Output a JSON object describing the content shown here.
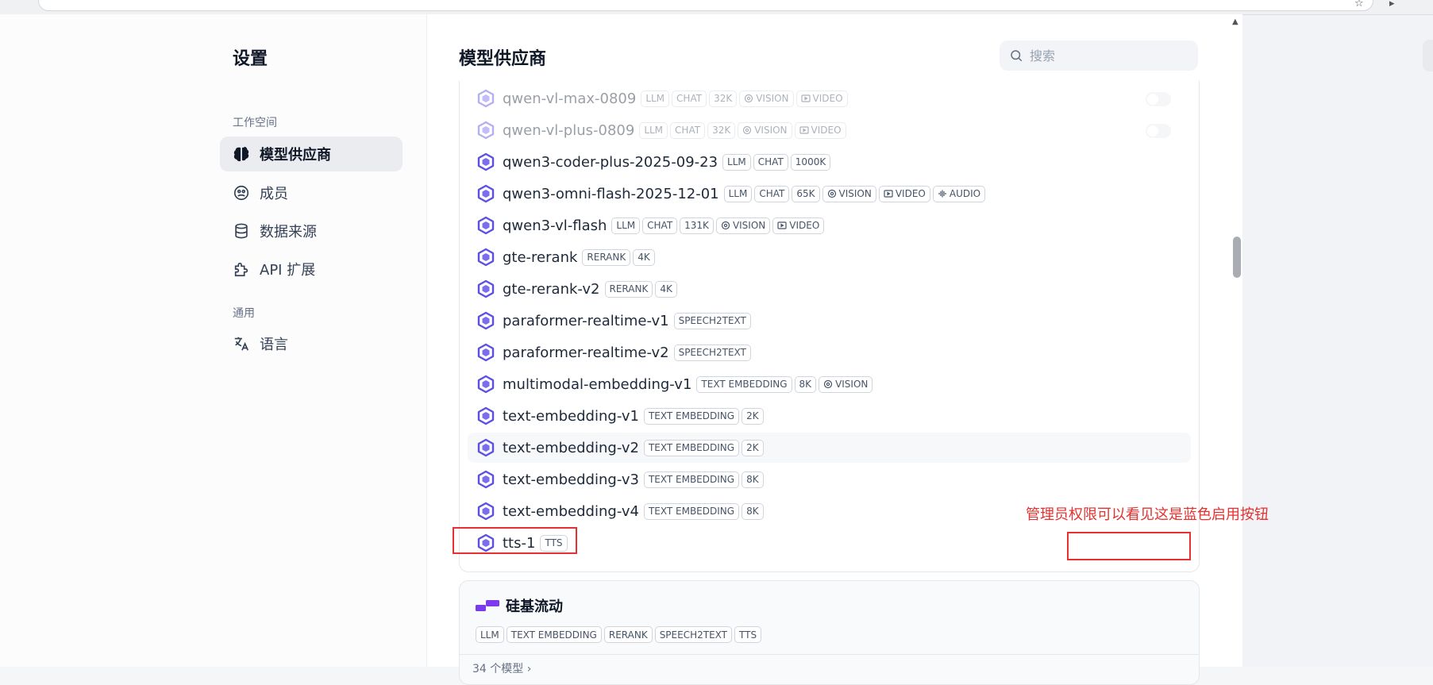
{
  "sidebar": {
    "title": "设置",
    "sections": [
      {
        "label": "工作空间",
        "items": [
          {
            "label": "模型供应商",
            "icon": "brain-icon",
            "active": true
          },
          {
            "label": "成员",
            "icon": "members-icon"
          },
          {
            "label": "数据来源",
            "icon": "database-icon"
          },
          {
            "label": "API 扩展",
            "icon": "puzzle-icon"
          }
        ]
      },
      {
        "label": "通用",
        "items": [
          {
            "label": "语言",
            "icon": "translate-icon"
          }
        ]
      }
    ]
  },
  "main": {
    "title": "模型供应商",
    "search": {
      "placeholder": "搜索",
      "value": ""
    }
  },
  "models": [
    {
      "name": "qwen-vl-max-0809",
      "tags": [
        "LLM",
        "CHAT",
        "32K",
        "VISION",
        "VIDEO"
      ],
      "disabled": true,
      "toggle": "off"
    },
    {
      "name": "qwen-vl-plus-0809",
      "tags": [
        "LLM",
        "CHAT",
        "32K",
        "VISION",
        "VIDEO"
      ],
      "disabled": true,
      "toggle": "off"
    },
    {
      "name": "qwen3-coder-plus-2025-09-23",
      "tags": [
        "LLM",
        "CHAT",
        "1000K"
      ]
    },
    {
      "name": "qwen3-omni-flash-2025-12-01",
      "tags": [
        "LLM",
        "CHAT",
        "65K",
        "VISION",
        "VIDEO",
        "AUDIO"
      ]
    },
    {
      "name": "qwen3-vl-flash",
      "tags": [
        "LLM",
        "CHAT",
        "131K",
        "VISION",
        "VIDEO"
      ]
    },
    {
      "name": "gte-rerank",
      "tags": [
        "RERANK",
        "4K"
      ]
    },
    {
      "name": "gte-rerank-v2",
      "tags": [
        "RERANK",
        "4K"
      ]
    },
    {
      "name": "paraformer-realtime-v1",
      "tags": [
        "SPEECH2TEXT"
      ]
    },
    {
      "name": "paraformer-realtime-v2",
      "tags": [
        "SPEECH2TEXT"
      ]
    },
    {
      "name": "multimodal-embedding-v1",
      "tags": [
        "TEXT EMBEDDING",
        "8K",
        "VISION"
      ]
    },
    {
      "name": "text-embedding-v1",
      "tags": [
        "TEXT EMBEDDING",
        "2K"
      ]
    },
    {
      "name": "text-embedding-v2",
      "tags": [
        "TEXT EMBEDDING",
        "2K"
      ],
      "hover": true
    },
    {
      "name": "text-embedding-v3",
      "tags": [
        "TEXT EMBEDDING",
        "8K"
      ]
    },
    {
      "name": "text-embedding-v4",
      "tags": [
        "TEXT EMBEDDING",
        "8K"
      ]
    },
    {
      "name": "tts-1",
      "tags": [
        "TTS"
      ]
    }
  ],
  "provider2": {
    "name": "硅基流动",
    "tags": [
      "LLM",
      "TEXT EMBEDDING",
      "RERANK",
      "SPEECH2TEXT",
      "TTS"
    ],
    "count": "34 个模型 ›"
  },
  "annotation": {
    "text": "管理员权限可以看见这是蓝色启用按钮",
    "color": "#e5312f"
  },
  "colors": {
    "accent": "#5b4fe6",
    "provider2_brand": "#7c3aed",
    "annotation": "#e5312f"
  }
}
